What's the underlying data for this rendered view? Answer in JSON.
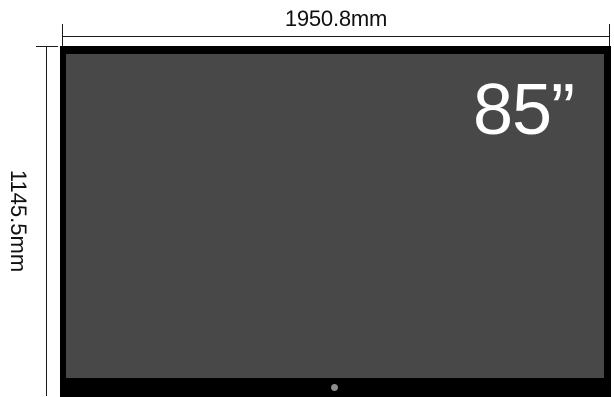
{
  "dimensions": {
    "width_label": "1950.8mm",
    "height_label": "1145.5mm"
  },
  "tv": {
    "size_label": "85”",
    "colors": {
      "bezel": "#000000",
      "screen": "#484848",
      "led": "#8e8e8e"
    },
    "icons": {
      "indicator": "power-indicator-dot"
    }
  }
}
